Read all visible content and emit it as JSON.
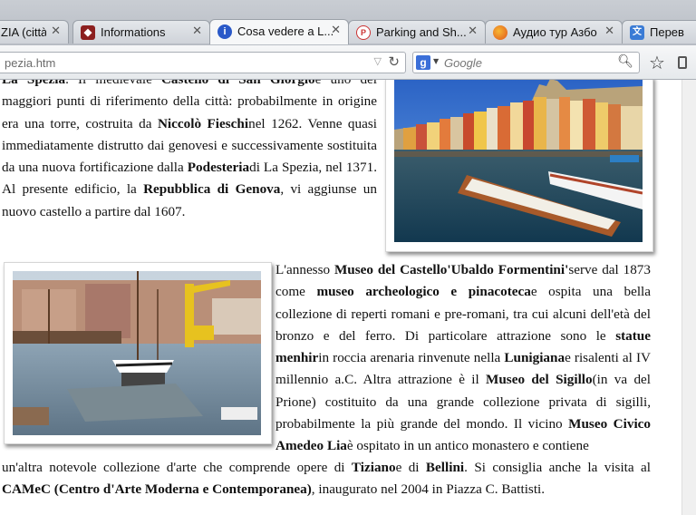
{
  "browser": {
    "tabs": [
      {
        "label": "ZIA (città...",
        "icon": "tab-page-icon",
        "active": false
      },
      {
        "label": "Informations",
        "icon": "tab-red-badge-icon",
        "active": false
      },
      {
        "label": "Cosa vedere a L...",
        "icon": "info-icon",
        "active": true
      },
      {
        "label": "Parking and Sh...",
        "icon": "parking-icon",
        "active": false
      },
      {
        "label": "Аудио тур Азбо",
        "icon": "firefox-icon",
        "active": false
      },
      {
        "label": "Перев",
        "icon": "translate-icon",
        "active": false
      }
    ],
    "close_glyph": "✕",
    "url": "pezia.htm",
    "search_placeholder": "Google",
    "search_engine_letter": "g"
  },
  "article": {
    "p1": [
      {
        "t": "La Spezia",
        "b": true
      },
      {
        "t": ". Il medievale ",
        "b": false
      },
      {
        "t": "Castello di San Giorgio",
        "b": true
      },
      {
        "t": "è uno dei maggiori punti di riferimento della città: probabilmente in origine era una torre, costruita da ",
        "b": false
      },
      {
        "t": "Niccolò Fieschi",
        "b": true
      },
      {
        "t": "nel 1262. Venne quasi immediatamente distrutto dai genovesi e successivamente sostituita da una nuova fortificazione dalla ",
        "b": false
      },
      {
        "t": "Podesteria",
        "b": true
      },
      {
        "t": "di La Spezia, nel 1371. Al presente edificio, la ",
        "b": false
      },
      {
        "t": "Repubblica di Genova",
        "b": true
      },
      {
        "t": ", vi aggiunse un nuovo castello a partire dal 1607.",
        "b": false
      }
    ],
    "p2": [
      {
        "t": "L'annesso ",
        "b": false
      },
      {
        "t": "Museo del Castello'Ubaldo Formentini'",
        "b": true
      },
      {
        "t": "serve dal 1873 come ",
        "b": false
      },
      {
        "t": "museo archeologico e pinacoteca",
        "b": true
      },
      {
        "t": "e ospita una bella collezione di reperti romani e pre-romani, tra cui alcuni dell'età del bronzo e del ferro. Di particolare attrazione sono le ",
        "b": false
      },
      {
        "t": "statue menhir",
        "b": true
      },
      {
        "t": "in roccia arenaria rinvenute nella ",
        "b": false
      },
      {
        "t": "Lunigiana",
        "b": true
      },
      {
        "t": "e risalenti al IV millennio a.C. Altra attrazione è il ",
        "b": false
      },
      {
        "t": "Museo del Sigillo",
        "b": true
      },
      {
        "t": "(in va del Prione) costituito da una grande collezione privata di sigilli, probabilmente la più grande del mondo. Il vicino ",
        "b": false
      },
      {
        "t": "Museo Civico Amedeo Lia",
        "b": true
      },
      {
        "t": "è ospitato in un antico monastero e contiene",
        "b": false
      }
    ],
    "p2b": [
      {
        "t": "un'altra notevole collezione d'arte che comprende opere di ",
        "b": false
      },
      {
        "t": "Tiziano",
        "b": true
      },
      {
        "t": "e di ",
        "b": false
      },
      {
        "t": "Bellini",
        "b": true
      },
      {
        "t": ". Si consiglia anche la visita al ",
        "b": false
      },
      {
        "t": "CAMeC (Centro d'Arte Moderna e Contemporanea)",
        "b": true
      },
      {
        "t": ", inaugurato nel 2004 in Piazza C. Battisti.",
        "b": false
      }
    ]
  },
  "colors": {
    "sky": "#2f6fd0",
    "sea": "#1e4f78",
    "boat_wood": "#a85a2a",
    "crane_yellow": "#e7c21f"
  }
}
